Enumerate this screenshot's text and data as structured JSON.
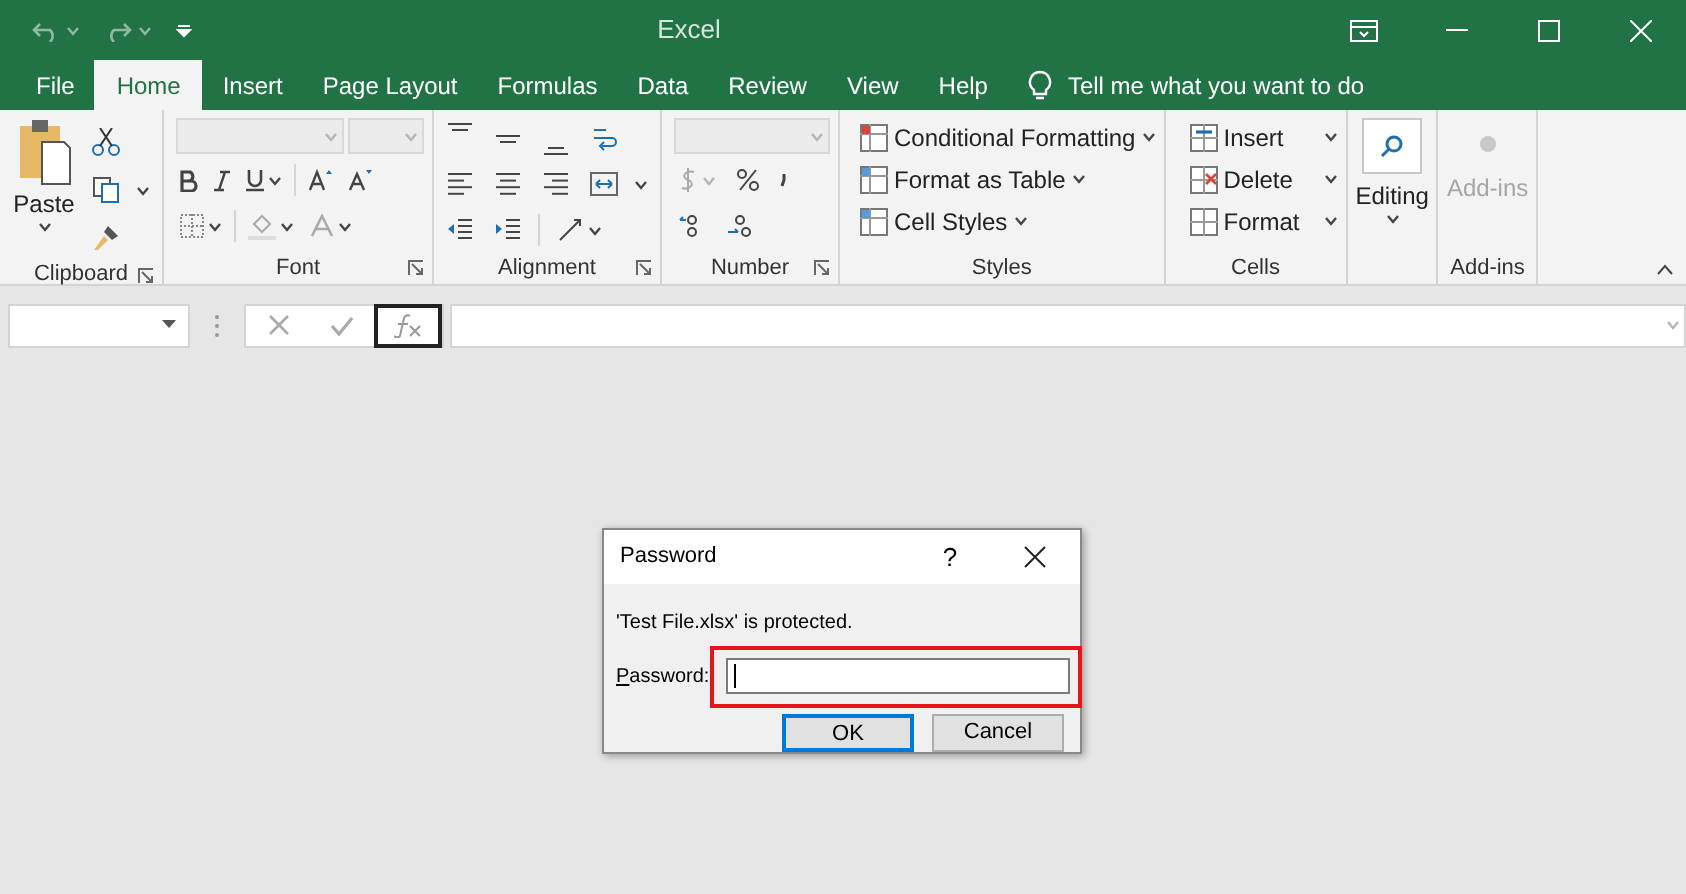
{
  "window": {
    "title": "Excel"
  },
  "tabs": [
    {
      "label": "File",
      "selected": false
    },
    {
      "label": "Home",
      "selected": true
    },
    {
      "label": "Insert",
      "selected": false
    },
    {
      "label": "Page Layout",
      "selected": false
    },
    {
      "label": "Formulas",
      "selected": false
    },
    {
      "label": "Data",
      "selected": false
    },
    {
      "label": "Review",
      "selected": false
    },
    {
      "label": "View",
      "selected": false
    },
    {
      "label": "Help",
      "selected": false
    }
  ],
  "tell_me": "Tell me what you want to do",
  "ribbon": {
    "clipboard": {
      "paste": "Paste",
      "label": "Clipboard"
    },
    "font": {
      "label": "Font"
    },
    "alignment": {
      "label": "Alignment"
    },
    "number": {
      "label": "Number"
    },
    "styles": {
      "items": [
        "Conditional Formatting",
        "Format as Table",
        "Cell Styles"
      ],
      "label": "Styles"
    },
    "cells": {
      "items": [
        "Insert",
        "Delete",
        "Format"
      ],
      "label": "Cells"
    },
    "editing": {
      "button": "Editing"
    },
    "addins": {
      "button": "Add-ins",
      "disabled": true,
      "label": "Add-ins"
    }
  },
  "dialog": {
    "title": "Password",
    "help": "?",
    "message": "'Test File.xlsx' is protected.",
    "field_label": "Password:",
    "buttons": [
      {
        "label": "OK",
        "default": true
      },
      {
        "label": "Cancel",
        "default": false
      }
    ]
  }
}
